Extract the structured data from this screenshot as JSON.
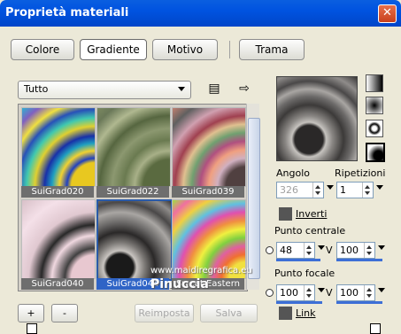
{
  "window": {
    "title": "Proprietà materiali",
    "close": "✕"
  },
  "tabs": [
    {
      "label": "Colore"
    },
    {
      "label": "Gradiente",
      "selected": true
    },
    {
      "label": "Motivo"
    },
    {
      "label": "Trama"
    }
  ],
  "category": {
    "value": "Tutto"
  },
  "gallery": [
    {
      "name": "SuiGrad020"
    },
    {
      "name": "SuiGrad022"
    },
    {
      "name": "SuiGrad039"
    },
    {
      "name": "SuiGrad040"
    },
    {
      "name": "SuiGrad044",
      "selected": true
    },
    {
      "name": "Sweet Eastern"
    }
  ],
  "buttons": {
    "add": "+",
    "remove": "-",
    "reset": "Reimposta",
    "save": "Salva"
  },
  "properties": {
    "angle_label": "Angolo",
    "angle_value": "326",
    "repeat_label": "Ripetizioni",
    "repeat_value": "1",
    "invert_label": "Inverti",
    "center_label": "Punto centrale",
    "center_x": "48",
    "center_y": "100",
    "focal_label": "Punto focale",
    "focal_x": "100",
    "focal_y": "100",
    "v_label": "V",
    "link_label": "Link"
  },
  "watermark": {
    "text": "Pinuccia",
    "url": "www.maidiregrafica.eu"
  }
}
